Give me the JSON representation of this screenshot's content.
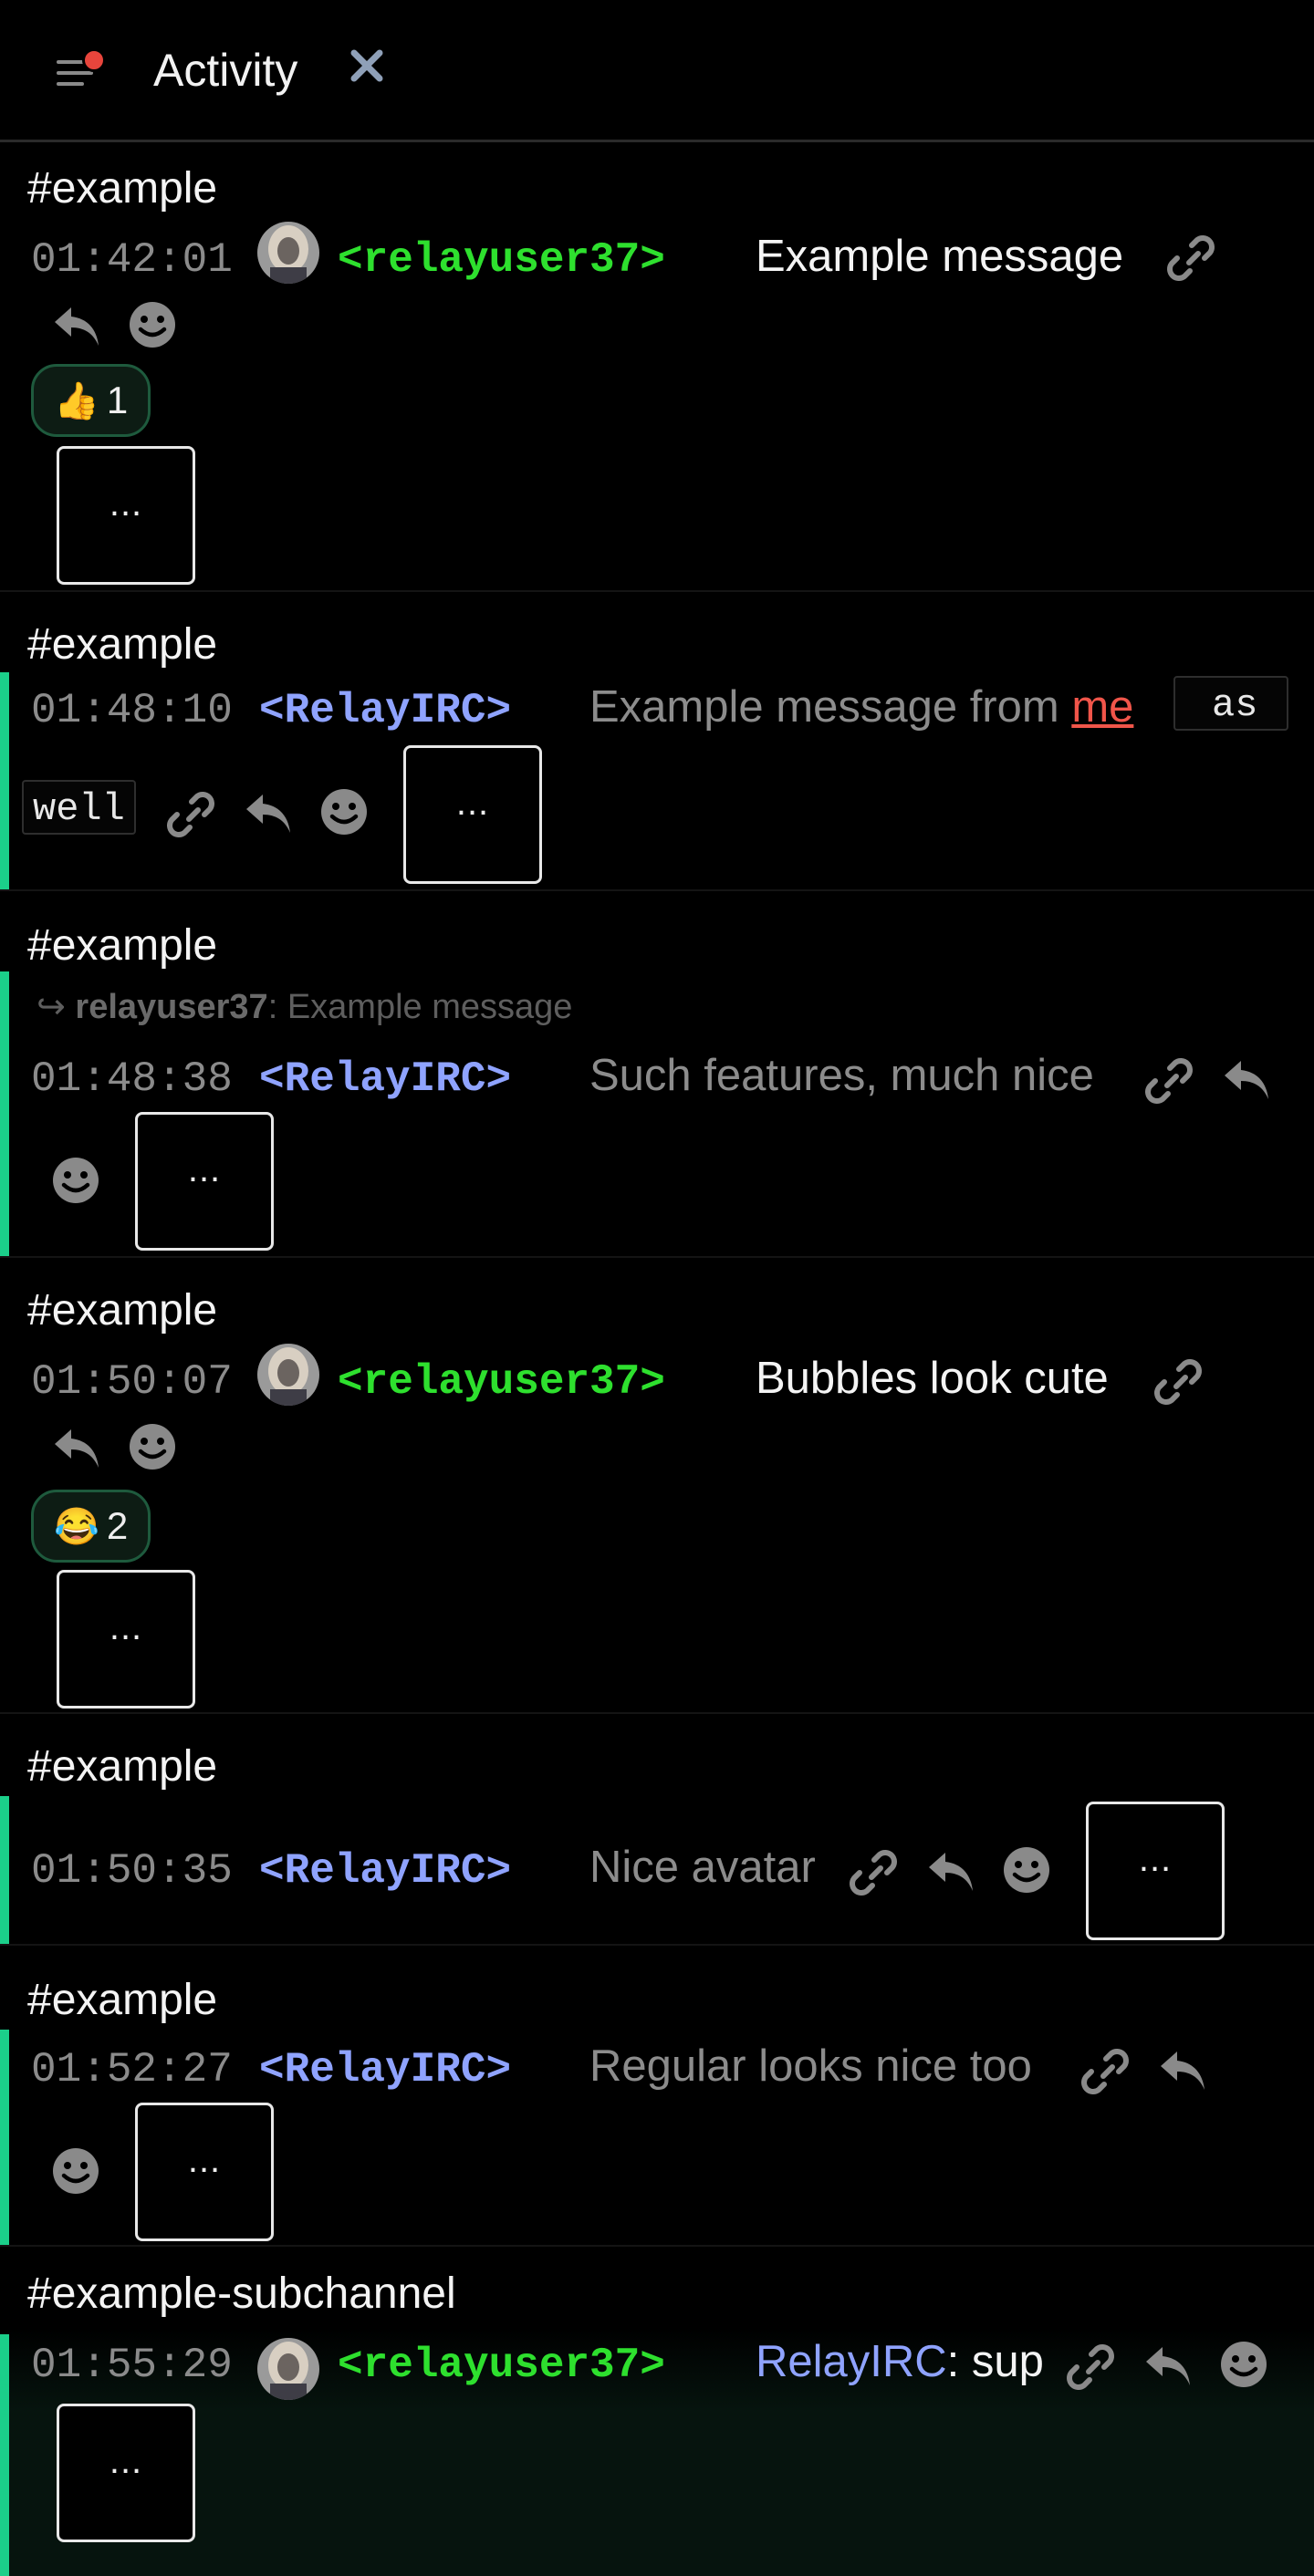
{
  "header": {
    "title": "Activity"
  },
  "icons": {
    "menu": "menu-icon",
    "close": "close-icon",
    "link": "link-icon",
    "reply": "reply-icon",
    "emoji": "emoji-icon"
  },
  "colors": {
    "accent": "#1bcf8a",
    "nick_self": "#2ee02e",
    "nick_bot": "#8fa3ff",
    "mention": "#f0554a",
    "unread_dot": "#e8453c"
  },
  "messages": [
    {
      "channel": "#example",
      "time": "01:42:01",
      "nick": "<relayuser37>",
      "text": "Example message",
      "reaction": {
        "emoji": "👍",
        "count": "1"
      },
      "more": "..."
    },
    {
      "channel": "#example",
      "time": "01:48:10",
      "nick": "<RelayIRC>",
      "text_before": "Example message from ",
      "mention": "me",
      "code1": "as",
      "code2": "well",
      "more": "..."
    },
    {
      "channel": "#example",
      "reply_to_nick": "relayuser37",
      "reply_to_text": ": Example message",
      "reply_arrow": "↪",
      "time": "01:48:38",
      "nick": "<RelayIRC>",
      "text": "Such features, much nice",
      "more": "..."
    },
    {
      "channel": "#example",
      "time": "01:50:07",
      "nick": "<relayuser37>",
      "text": "Bubbles look cute",
      "reaction": {
        "emoji": "😂",
        "count": "2"
      },
      "more": "..."
    },
    {
      "channel": "#example",
      "time": "01:50:35",
      "nick": "<RelayIRC>",
      "text": "Nice avatar",
      "more": "..."
    },
    {
      "channel": "#example",
      "time": "01:52:27",
      "nick": "<RelayIRC>",
      "text": "Regular looks nice too",
      "more": "..."
    },
    {
      "channel": "#example-subchannel",
      "time": "01:55:29",
      "nick": "<relayuser37>",
      "mention_nick": "RelayIRC",
      "text": ": sup",
      "more": "..."
    }
  ]
}
